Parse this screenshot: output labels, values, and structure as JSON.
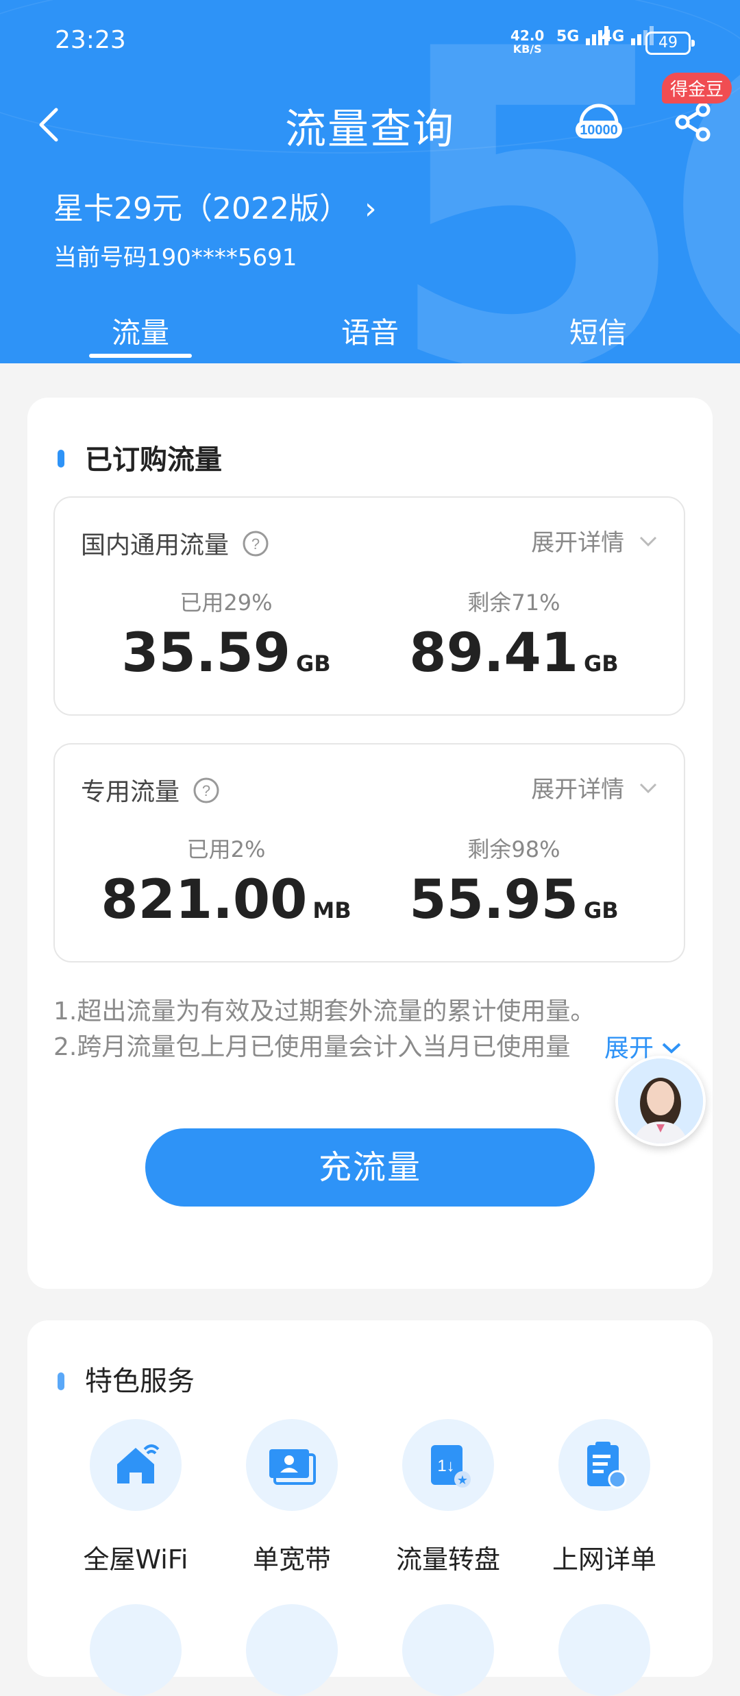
{
  "status_bar": {
    "time": "23:23",
    "net_speed_value": "42.0",
    "net_speed_unit": "KB/S",
    "sig1": "5G",
    "sig2": "4G",
    "battery": "49"
  },
  "navbar": {
    "title": "流量查询",
    "badge": "得金豆",
    "service_icon": "headset-10000-icon",
    "share_icon": "share-icon"
  },
  "plan": {
    "name": "星卡29元（2022版）",
    "chevron": "›",
    "phone": "当前号码190****5691"
  },
  "tabs": [
    {
      "label": "流量",
      "active": true
    },
    {
      "label": "语音",
      "active": false
    },
    {
      "label": "短信",
      "active": false
    }
  ],
  "subscribed": {
    "title": "已订购流量",
    "domestic": {
      "title": "国内通用流量",
      "detail": "展开详情",
      "used_label": "已用29%",
      "used_value": "35.59",
      "used_unit": "GB",
      "remain_label": "剩余71%",
      "remain_value": "89.41",
      "remain_unit": "GB",
      "used_percent": 29
    },
    "dedicated": {
      "title": "专用流量",
      "detail": "展开详情",
      "used_label": "已用2%",
      "used_value": "821.00",
      "used_unit": "MB",
      "remain_label": "剩余98%",
      "remain_value": "55.95",
      "remain_unit": "GB",
      "used_percent": 2
    },
    "notes": [
      "1.超出流量为有效及过期套外流量的累计使用量。",
      "2.跨月流量包上月已使用量会计入当月已使用量"
    ],
    "expand": "展开",
    "recharge": "充流量"
  },
  "services": {
    "title": "特色服务",
    "items": [
      {
        "label": "全屋WiFi",
        "icon": "home-wifi-icon"
      },
      {
        "label": "单宽带",
        "icon": "broadband-card-icon"
      },
      {
        "label": "流量转盘",
        "icon": "data-transfer-icon"
      },
      {
        "label": "上网详单",
        "icon": "clipboard-details-icon"
      }
    ]
  },
  "colors": {
    "primary": "#2e93f7",
    "badge": "#f04d52",
    "background": "#f4f4f4"
  }
}
